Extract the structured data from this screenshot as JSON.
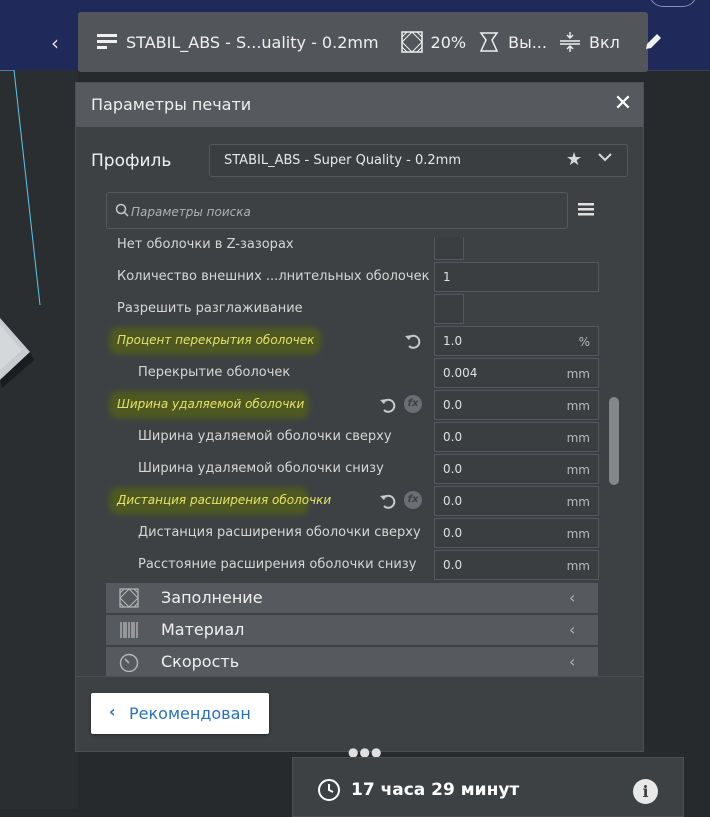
{
  "header": {
    "profile_name": "STABIL_ABS - S...uality - 0.2mm",
    "infill_percent": "20%",
    "support_label": "Вы...",
    "adhesion_label": "Вкл"
  },
  "panel": {
    "title": "Параметры печати",
    "profile_label": "Профиль",
    "profile_value": "STABIL_ABS - Super Quality - 0.2mm",
    "search_placeholder": "Параметры поиска"
  },
  "settings": [
    {
      "label": "Нет оболочки в Z-зазорах",
      "type": "checkbox"
    },
    {
      "label": "Количество внешних ...лнительных оболочек",
      "type": "value",
      "value": "1",
      "unit": ""
    },
    {
      "label": "Разрешить разглаживание",
      "type": "checkbox"
    },
    {
      "label": "Процент перекрытия оболочек",
      "type": "value",
      "value": "1.0",
      "unit": "%",
      "highlight": true,
      "reset": true
    },
    {
      "label": "Перекрытие оболочек",
      "type": "value",
      "value": "0.004",
      "unit": "mm",
      "indent": true
    },
    {
      "label": "Ширина удаляемой оболочки",
      "type": "value",
      "value": "0.0",
      "unit": "mm",
      "highlight": true,
      "reset": true,
      "fx": true
    },
    {
      "label": "Ширина удаляемой оболочки сверху",
      "type": "value",
      "value": "0.0",
      "unit": "mm",
      "indent": true
    },
    {
      "label": "Ширина удаляемой оболочки снизу",
      "type": "value",
      "value": "0.0",
      "unit": "mm",
      "indent": true
    },
    {
      "label": "Дистанция расширения оболочки",
      "type": "value",
      "value": "0.0",
      "unit": "mm",
      "highlight": true,
      "reset": true,
      "fx": true
    },
    {
      "label": "Дистанция расширения оболочки сверху",
      "type": "value",
      "value": "0.0",
      "unit": "mm",
      "indent": true
    },
    {
      "label": "Расстояние расширения оболочки снизу",
      "type": "value",
      "value": "0.0",
      "unit": "mm",
      "indent": true
    }
  ],
  "categories": [
    {
      "label": "Заполнение",
      "icon": "infill-icon"
    },
    {
      "label": "Материал",
      "icon": "material-icon"
    },
    {
      "label": "Скорость",
      "icon": "speed-icon"
    }
  ],
  "footer": {
    "recommended_label": "Рекомендован"
  },
  "print_time": {
    "label": "17 часа 29 минут"
  },
  "colors": {
    "highlight_text": "#e3e36a",
    "accent_blue": "#2a6fc0"
  }
}
